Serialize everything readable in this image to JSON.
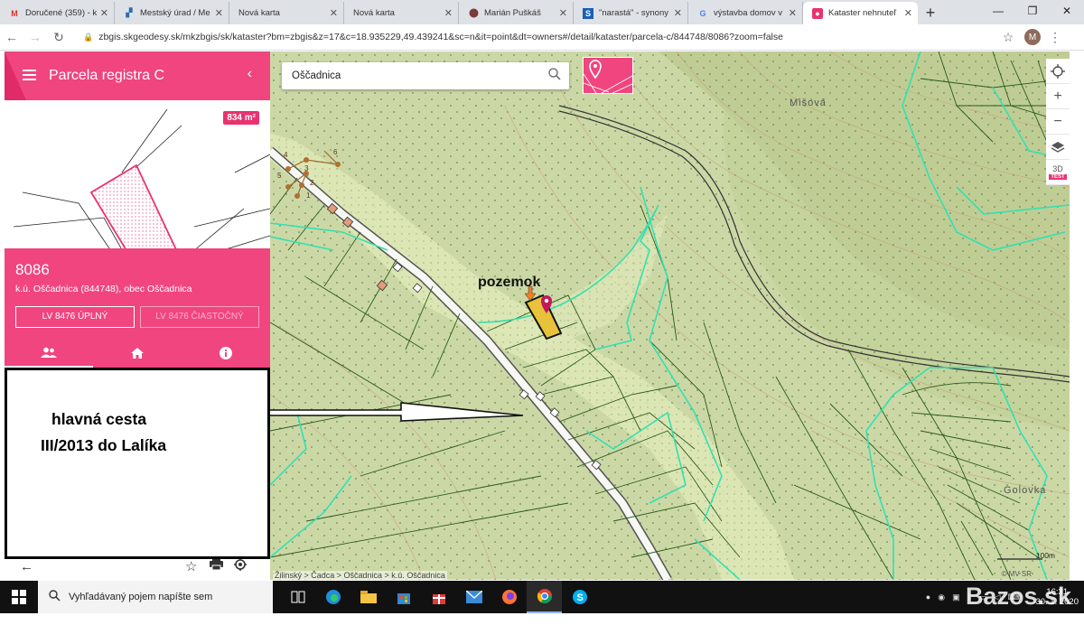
{
  "tabs": [
    {
      "title": "Doručené (359) - k",
      "icon": "gmail-icon"
    },
    {
      "title": "Mestský úrad / Me",
      "icon": "city-icon"
    },
    {
      "title": "Nová karta",
      "icon": "blank-icon"
    },
    {
      "title": "Nová karta",
      "icon": "blank-icon"
    },
    {
      "title": "Marián Puškáš",
      "icon": "profile-icon"
    },
    {
      "title": "\"narastá\" - synony",
      "icon": "s-icon"
    },
    {
      "title": "výstavba domov v",
      "icon": "google-icon"
    },
    {
      "title": "Kataster nehnuteľ",
      "icon": "kataster-icon"
    }
  ],
  "address": {
    "url": "zbgis.skgeodesy.sk/mkzbgis/sk/kataster?bm=zbgis&z=17&c=18.935229,49.439241&sc=n&it=point&dt=owners#/detail/kataster/parcela-c/844748/8086?zoom=false",
    "avatar_letter": "M"
  },
  "panel": {
    "title": "Parcela registra C",
    "area": "834 m²",
    "parcel_number": "8086",
    "subtitle": "k.ú. Oščadnica (844748), obec Oščadnica",
    "btn_full": "LV 8476 ÚPLNÝ",
    "btn_partial": "LV 8476 ČIASTOČNÝ"
  },
  "annotation": {
    "line1": "hlavná cesta",
    "line2": "III/2013 do Lalíka"
  },
  "map": {
    "search_value": "Oščadnica",
    "label_pozemok": "pozemok",
    "place_misova": "Mišová",
    "place_golovka": "Golovka",
    "breadcrumb": "Žilinský > Čadca > Oščadnica > k.ú. Oščadnica",
    "scale_label": "100m",
    "copyright": "© MV SR",
    "three_d": "3D",
    "test_badge": "TEST",
    "parcel_marks": [
      "4",
      "6",
      "5",
      "3",
      "2",
      "1"
    ]
  },
  "taskbar": {
    "search_placeholder": "Vyhľadávaný pojem napíšte sem",
    "time": "16:31",
    "date": "30. 1. 2020",
    "watermark": "Bazos.sk"
  },
  "colors": {
    "accent": "#f0457f",
    "map_bg": "#c9d6a2",
    "boundary_teal": "#33e0b0",
    "parcel_line": "#2a5a1a"
  }
}
